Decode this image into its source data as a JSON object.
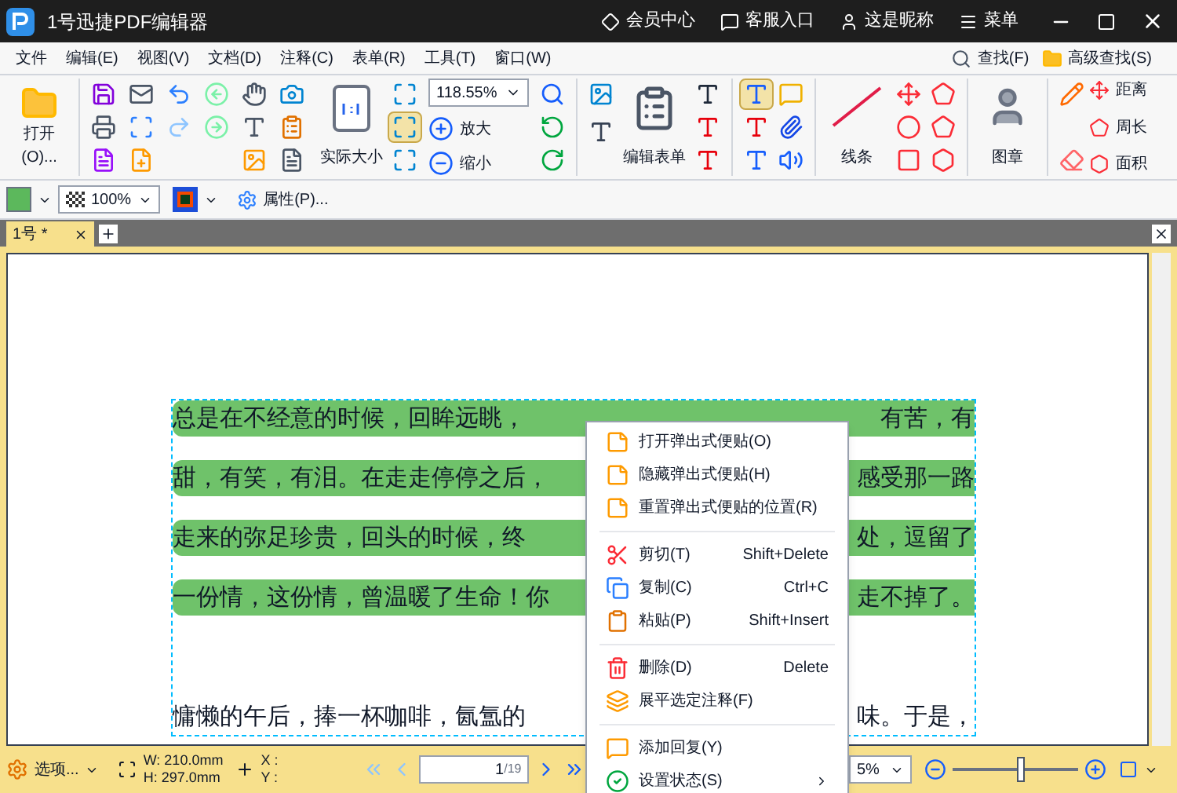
{
  "window": {
    "title": "1号迅捷PDF编辑器",
    "links": [
      "会员中心",
      "客服入口",
      "这是昵称",
      "菜单"
    ]
  },
  "menu_bar": {
    "items": [
      "文件",
      "编辑(E)",
      "视图(V)",
      "文档(D)",
      "注释(C)",
      "表单(R)",
      "工具(T)",
      "窗口(W)"
    ],
    "find": "查找(F)",
    "advanced_find": "高级查找(S)"
  },
  "ribbon": {
    "open": "打开(O)...",
    "actual_size": "实际大小",
    "zoom_value": "118.55%",
    "zoom_in": "放大",
    "zoom_out": "缩小",
    "fit_modes": [
      {
        "selected": false
      },
      {
        "selected": true
      },
      {
        "selected": false
      }
    ],
    "edit_form": "编辑表单",
    "text_tools": [
      {
        "selected": true
      },
      {
        "selected": false
      },
      {
        "selected": false
      }
    ],
    "line": "线条",
    "stamp": "图章",
    "measure": [
      "距离",
      "周长",
      "面积"
    ]
  },
  "properties_bar": {
    "opacity": "100%",
    "properties": "属性(P)..."
  },
  "tabs": [
    {
      "label": "1号 *",
      "selected": true
    }
  ],
  "document": {
    "lines": [
      {
        "left": "总是在不经意的时候，回眸远眺，",
        "right": "有苦，有",
        "highlighted": true
      },
      {
        "left": "甜，有笑，有泪。在走走停停之后，",
        "right": "感受那一路",
        "highlighted": true
      },
      {
        "left": "走来的弥足珍贵，回头的时候，终",
        "right": "处，逗留了",
        "highlighted": true
      },
      {
        "left": "一份情，这份情，曾温暖了生命！你",
        "right": "走不掉了。",
        "highlighted": true
      },
      {
        "left": "慵懒的午后，捧一杯咖啡，氤氲的",
        "right": "味。于是，",
        "highlighted": false
      }
    ]
  },
  "context_menu": [
    {
      "kind": "item",
      "label": "打开弹出式便贴(O)"
    },
    {
      "kind": "item",
      "label": "隐藏弹出式便贴(H)"
    },
    {
      "kind": "item",
      "label": "重置弹出式便贴的位置(R)"
    },
    {
      "kind": "separator"
    },
    {
      "kind": "item",
      "label": "剪切(T)",
      "shortcut": "Shift+Delete"
    },
    {
      "kind": "item",
      "label": "复制(C)",
      "shortcut": "Ctrl+C"
    },
    {
      "kind": "item",
      "label": "粘贴(P)",
      "shortcut": "Shift+Insert"
    },
    {
      "kind": "separator"
    },
    {
      "kind": "item",
      "label": "删除(D)",
      "shortcut": "Delete"
    },
    {
      "kind": "item",
      "label": "展平选定注释(F)"
    },
    {
      "kind": "separator"
    },
    {
      "kind": "item",
      "label": "添加回复(Y)"
    },
    {
      "kind": "submenu",
      "label": "设置状态(S)"
    }
  ],
  "status_bar": {
    "options": "选项...",
    "width": "W: 210.0mm",
    "height": "H: 297.0mm",
    "x": "X :",
    "y": "Y :",
    "page": "1",
    "page_count": "/19",
    "zoom": "5%",
    "level": 0.55
  }
}
